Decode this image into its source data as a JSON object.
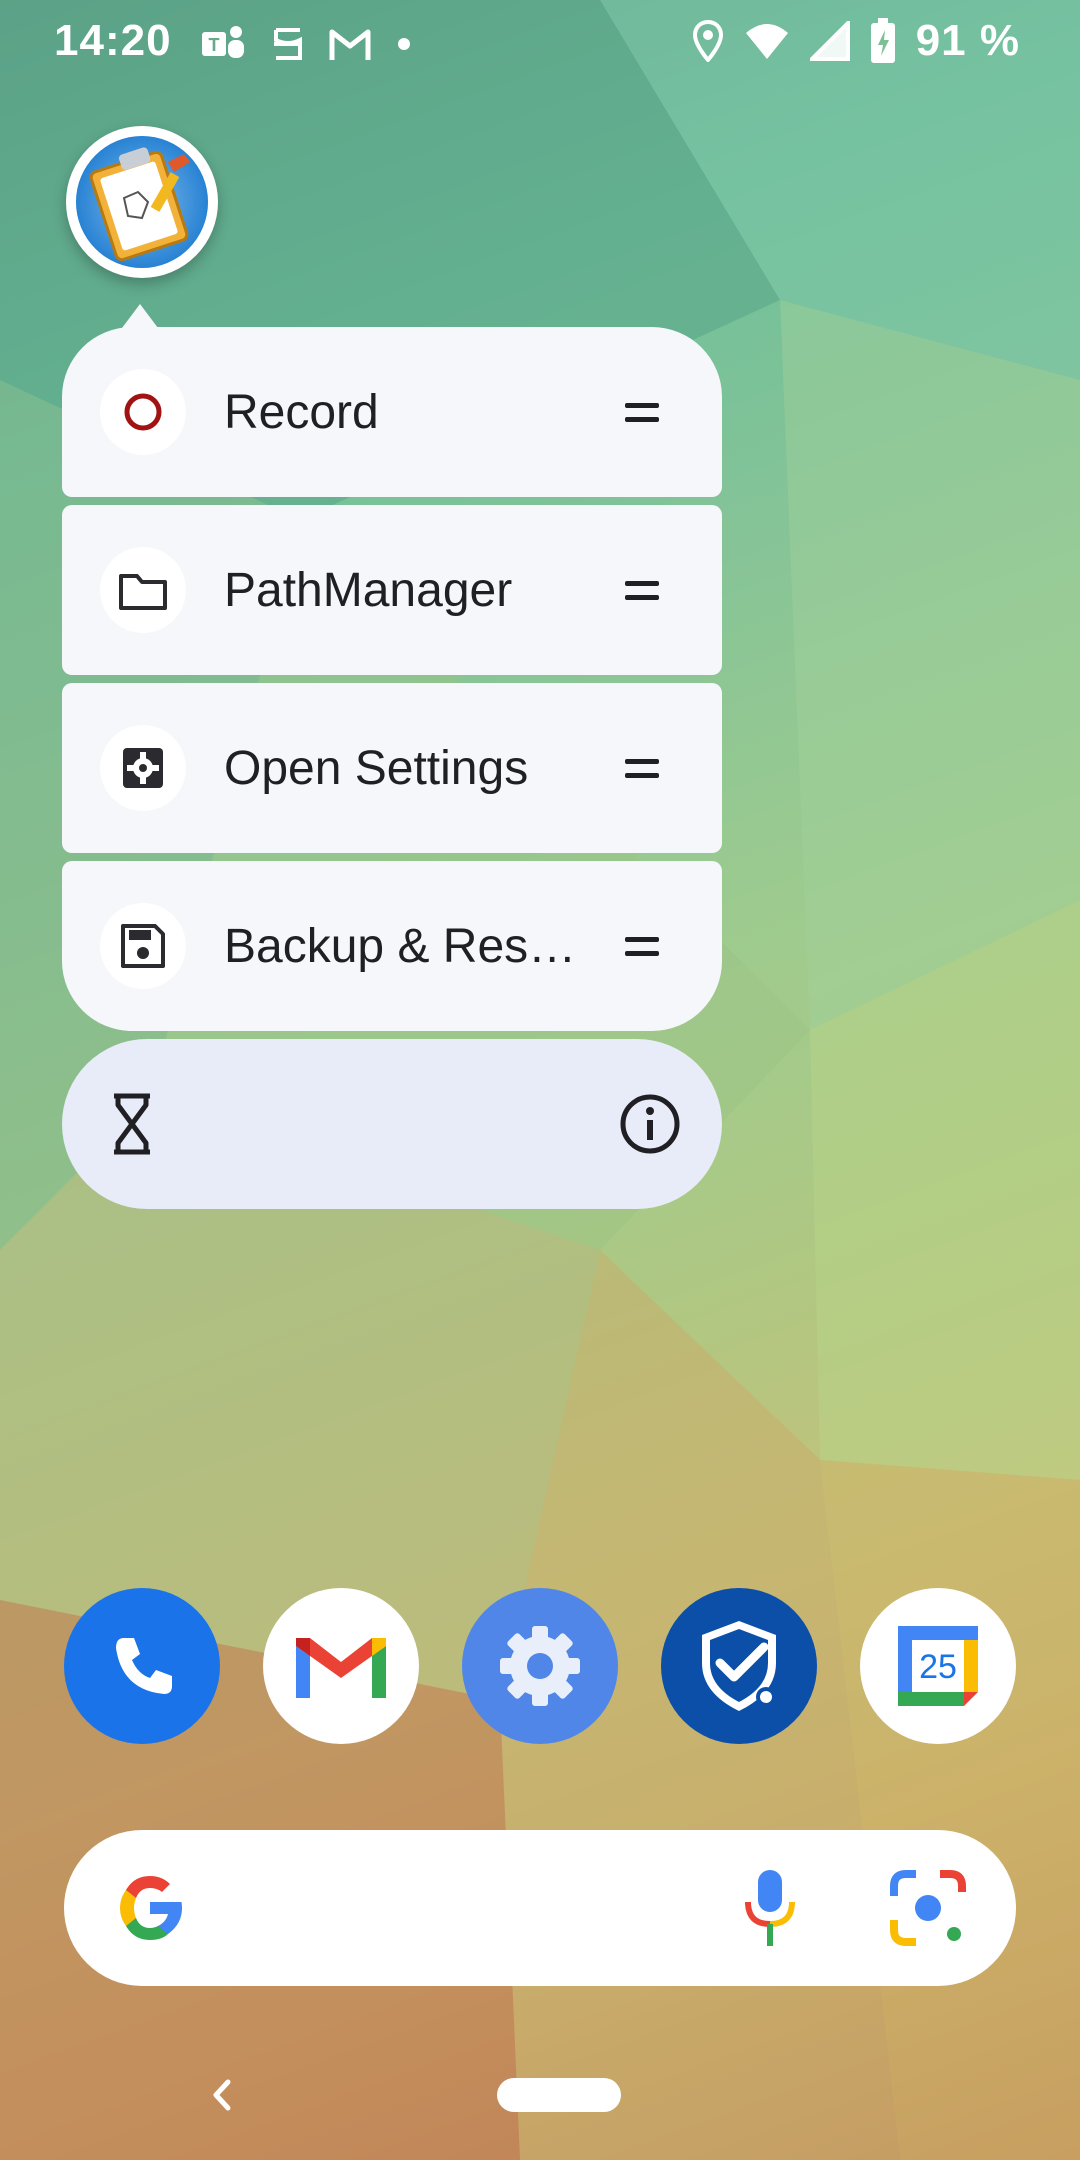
{
  "status_bar": {
    "time": "14:20",
    "left_icons": [
      "teams-icon",
      "scribe-icon",
      "gmail-icon",
      "dot-icon"
    ],
    "right_icons": [
      "location-icon",
      "wifi-icon",
      "signal-icon",
      "battery-charging-icon"
    ],
    "battery_percent": "91 %"
  },
  "popup": {
    "app_icon": "clipboard-app-icon",
    "items": [
      {
        "label": "Record",
        "icon": "record-icon"
      },
      {
        "label": "PathManager",
        "icon": "folder-icon"
      },
      {
        "label": "Open Settings",
        "icon": "settings-icon"
      },
      {
        "label": "Backup & Res…",
        "icon": "floppy-icon"
      }
    ],
    "actions": {
      "left_icon": "hourglass-icon",
      "right_icon": "info-icon"
    }
  },
  "dock": {
    "apps": [
      "phone-icon",
      "gmail-icon",
      "settings-icon",
      "shield-check-icon",
      "calendar-icon"
    ],
    "calendar_date": "25"
  },
  "search": {
    "icons": [
      "google-logo-icon",
      "mic-icon",
      "lens-icon"
    ]
  },
  "nav": {
    "icons": [
      "back-icon",
      "home-pill"
    ]
  }
}
